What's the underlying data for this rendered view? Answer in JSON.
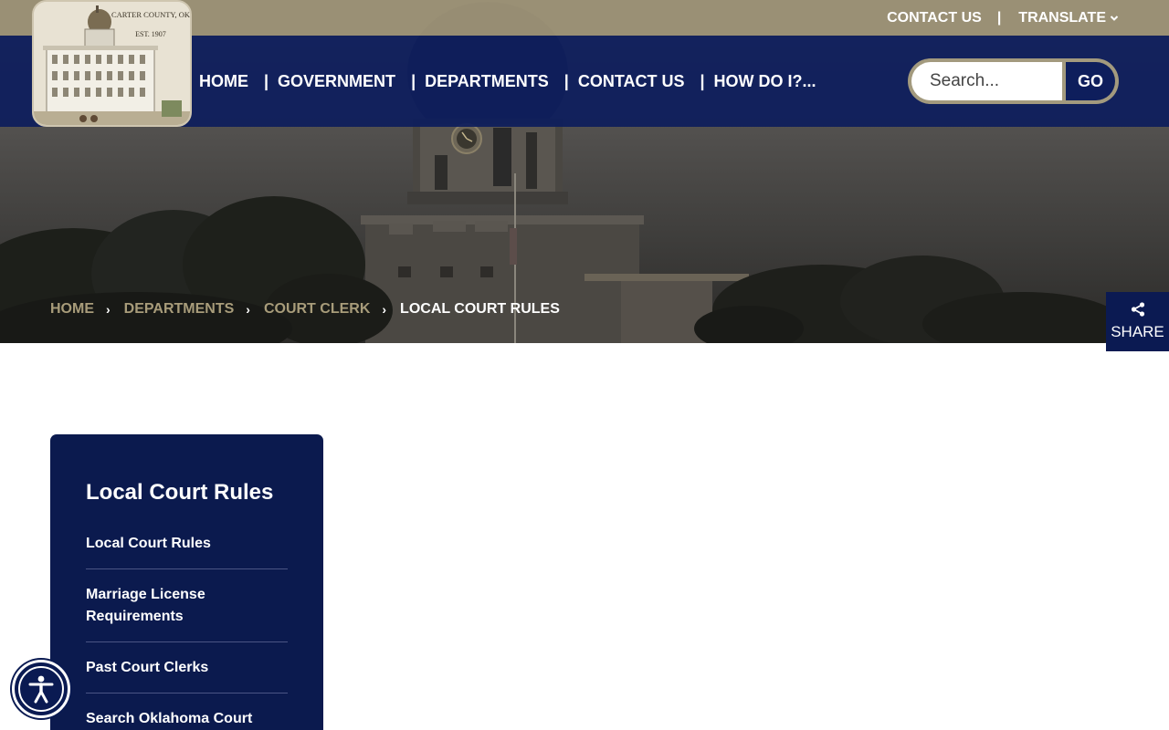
{
  "logo": {
    "line1": "CARTER COUNTY, OK",
    "line2": "EST. 1907"
  },
  "utility": {
    "contact": "CONTACT US",
    "separator": "|",
    "translate": "TRANSLATE"
  },
  "nav": {
    "items": [
      "HOME",
      "GOVERNMENT",
      "DEPARTMENTS",
      "CONTACT US",
      "HOW DO I?..."
    ],
    "separator": "|"
  },
  "search": {
    "placeholder": "Search...",
    "button": "GO"
  },
  "breadcrumb": {
    "items": [
      "HOME",
      "DEPARTMENTS",
      "COURT CLERK"
    ],
    "current": "LOCAL COURT RULES"
  },
  "share": {
    "label": "SHARE"
  },
  "sidebar": {
    "title": "Local Court Rules",
    "items": [
      "Local Court Rules",
      "Marriage License Requirements",
      "Past Court Clerks",
      "Search Oklahoma Court"
    ]
  },
  "colors": {
    "navy": "#0d1d5c",
    "gold": "#a89c7a",
    "utility_bar": "#9c9276"
  },
  "icons": {
    "translate": "chevron-down-icon",
    "breadcrumb": "chevron-right-icon",
    "share": "share-icon",
    "accessibility": "accessibility-icon"
  }
}
